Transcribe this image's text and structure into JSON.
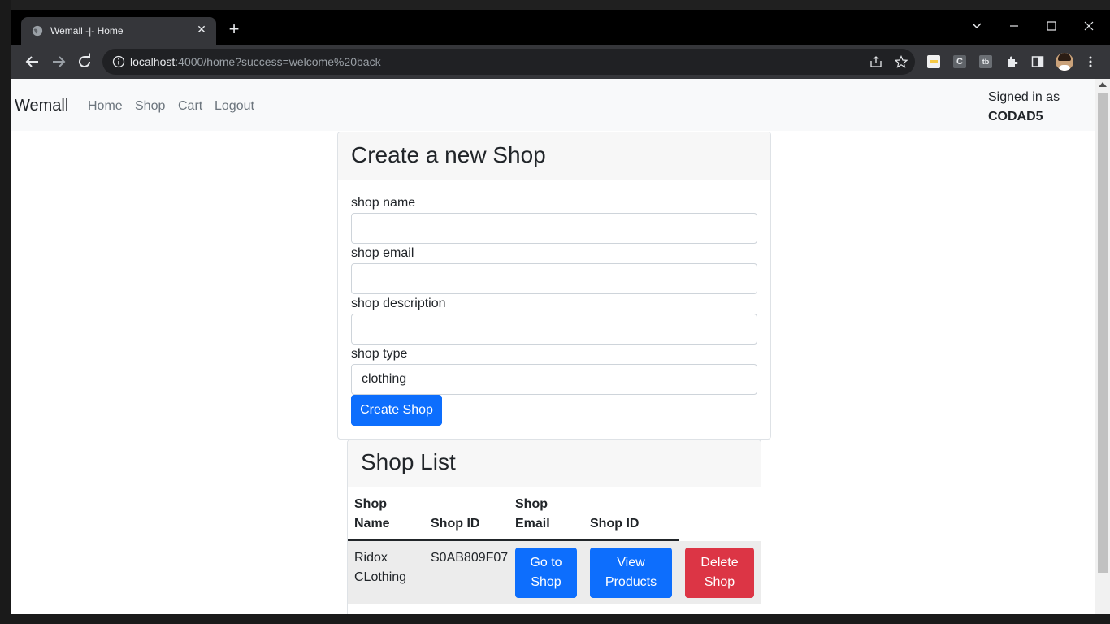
{
  "browser": {
    "tab_title": "Wemall -|- Home",
    "tab_close": "✕",
    "new_tab": "+",
    "url_host": "localhost",
    "url_rest": ":4000/home?success=welcome%20back",
    "icons": [
      "back-icon",
      "forward-icon",
      "reload-icon",
      "site-info-icon",
      "share-icon",
      "bookmark-star-icon",
      "extensions-icon",
      "side-panel-icon",
      "profile-avatar",
      "menu-icon"
    ]
  },
  "navbar": {
    "brand": "Wemall",
    "links": [
      "Home",
      "Shop",
      "Cart",
      "Logout"
    ],
    "signed_in_label": "Signed in as",
    "username": "CODAD5"
  },
  "create_shop": {
    "title": "Create a new Shop",
    "fields": {
      "name_label": "shop name",
      "name_value": "",
      "email_label": "shop email",
      "email_value": "",
      "description_label": "shop description",
      "description_value": "",
      "type_label": "shop type",
      "type_value": "clothing"
    },
    "submit_label": "Create Shop"
  },
  "shop_list": {
    "title": "Shop List",
    "headers": [
      "Shop Name",
      "Shop ID",
      "Shop Email",
      "Shop ID"
    ],
    "rows": [
      {
        "name": "Ridox CLothing",
        "id": "S0AB809F07",
        "go_label": "Go to Shop",
        "view_label": "View Products",
        "delete_label": "Delete Shop"
      }
    ]
  },
  "colors": {
    "primary": "#0d6efd",
    "danger": "#dc3545",
    "navbar_bg": "#f8f9fa",
    "browser_chrome": "#35363a"
  }
}
